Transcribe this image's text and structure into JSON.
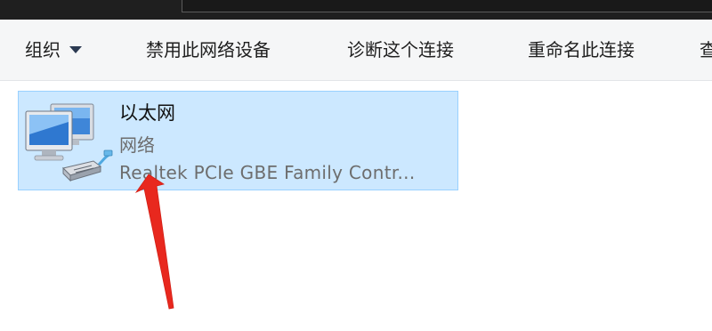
{
  "toolbar": {
    "organize_label": "组织",
    "disable_label": "禁用此网络设备",
    "diagnose_label": "诊断这个连接",
    "rename_label": "重命名此连接",
    "more_label": "查"
  },
  "adapter": {
    "name": "以太网",
    "status": "网络",
    "device": "Realtek PCIe GBE Family Contr..."
  },
  "icons": {
    "caret": "chevron-down-icon",
    "adapter": "network-adapter-icon",
    "arrow": "red-arrow-annotation"
  },
  "colors": {
    "selection_bg": "#cce8ff",
    "selection_border": "#99d1ff",
    "toolbar_bg": "#f5f6f7",
    "arrow": "#e8281e"
  }
}
